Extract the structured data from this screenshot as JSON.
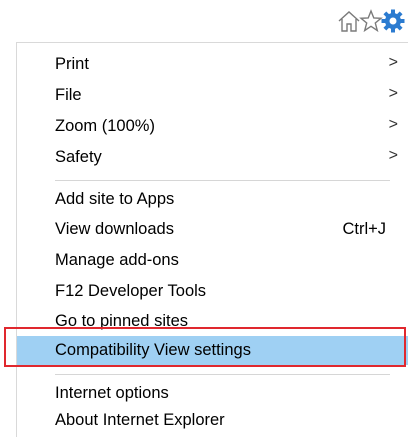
{
  "toolbar": {
    "icons": [
      "home-icon",
      "star-icon",
      "gear-icon"
    ]
  },
  "menu": {
    "group1": [
      {
        "label": "Print",
        "arrow": ">"
      },
      {
        "label": "File",
        "arrow": ">"
      },
      {
        "label": "Zoom (100%)",
        "arrow": ">"
      },
      {
        "label": "Safety",
        "arrow": ">"
      }
    ],
    "group2": [
      {
        "label": "Add site to Apps"
      },
      {
        "label": "View downloads",
        "shortcut": "Ctrl+J"
      },
      {
        "label": "Manage add-ons"
      },
      {
        "label": "F12 Developer Tools"
      },
      {
        "label": "Go to pinned sites"
      },
      {
        "label": "Compatibility View settings"
      }
    ],
    "group3": [
      {
        "label": "Internet options"
      },
      {
        "label": "About Internet Explorer"
      }
    ]
  },
  "colors": {
    "gear": "#2b7bd0",
    "highlight": "#9fd0f3",
    "annotation_border": "#e0282e"
  }
}
